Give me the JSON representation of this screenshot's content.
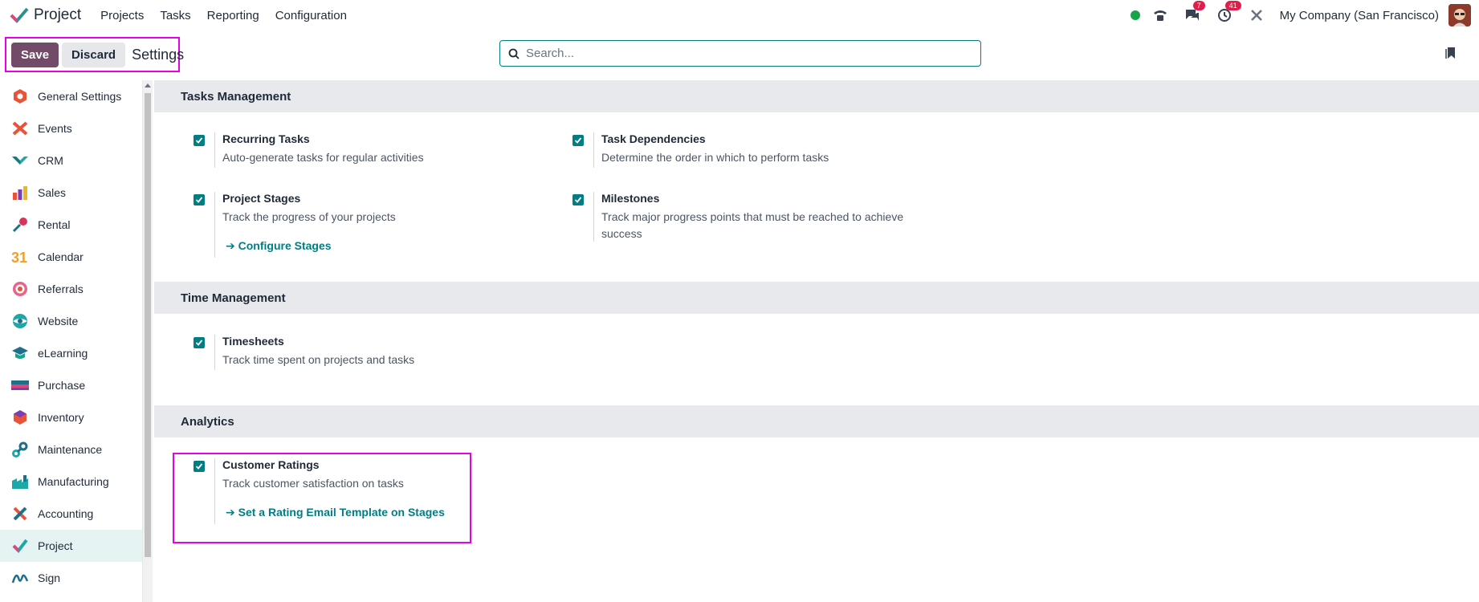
{
  "app": {
    "name": "Project"
  },
  "menu": [
    "Projects",
    "Tasks",
    "Reporting",
    "Configuration"
  ],
  "systray": {
    "messages_count": "7",
    "activities_count": "41",
    "company": "My Company (San Francisco)"
  },
  "control": {
    "save_label": "Save",
    "discard_label": "Discard",
    "title": "Settings"
  },
  "search": {
    "placeholder": "Search..."
  },
  "sidebar": {
    "items": [
      {
        "label": "General Settings",
        "icon": "general-settings-icon"
      },
      {
        "label": "Events",
        "icon": "events-icon"
      },
      {
        "label": "CRM",
        "icon": "crm-icon"
      },
      {
        "label": "Sales",
        "icon": "sales-icon"
      },
      {
        "label": "Rental",
        "icon": "rental-icon"
      },
      {
        "label": "Calendar",
        "icon": "calendar-icon"
      },
      {
        "label": "Referrals",
        "icon": "referrals-icon"
      },
      {
        "label": "Website",
        "icon": "website-icon"
      },
      {
        "label": "eLearning",
        "icon": "elearning-icon"
      },
      {
        "label": "Purchase",
        "icon": "purchase-icon"
      },
      {
        "label": "Inventory",
        "icon": "inventory-icon"
      },
      {
        "label": "Maintenance",
        "icon": "maintenance-icon"
      },
      {
        "label": "Manufacturing",
        "icon": "manufacturing-icon"
      },
      {
        "label": "Accounting",
        "icon": "accounting-icon"
      },
      {
        "label": "Project",
        "icon": "project-icon",
        "active": true
      },
      {
        "label": "Sign",
        "icon": "sign-icon"
      }
    ]
  },
  "sections": {
    "tasks": {
      "title": "Tasks Management",
      "recurring": {
        "title": "Recurring Tasks",
        "desc": "Auto-generate tasks for regular activities",
        "checked": true
      },
      "dependencies": {
        "title": "Task Dependencies",
        "desc": "Determine the order in which to perform tasks",
        "checked": true
      },
      "stages": {
        "title": "Project Stages",
        "desc": "Track the progress of your projects",
        "link": "Configure Stages",
        "checked": true
      },
      "milestones": {
        "title": "Milestones",
        "desc": "Track major progress points that must be reached to achieve success",
        "checked": true
      }
    },
    "time": {
      "title": "Time Management",
      "timesheets": {
        "title": "Timesheets",
        "desc": "Track time spent on projects and tasks",
        "checked": true
      }
    },
    "analytics": {
      "title": "Analytics",
      "ratings": {
        "title": "Customer Ratings",
        "desc": "Track customer satisfaction on tasks",
        "link": "Set a Rating Email Template on Stages",
        "checked": true
      }
    }
  }
}
